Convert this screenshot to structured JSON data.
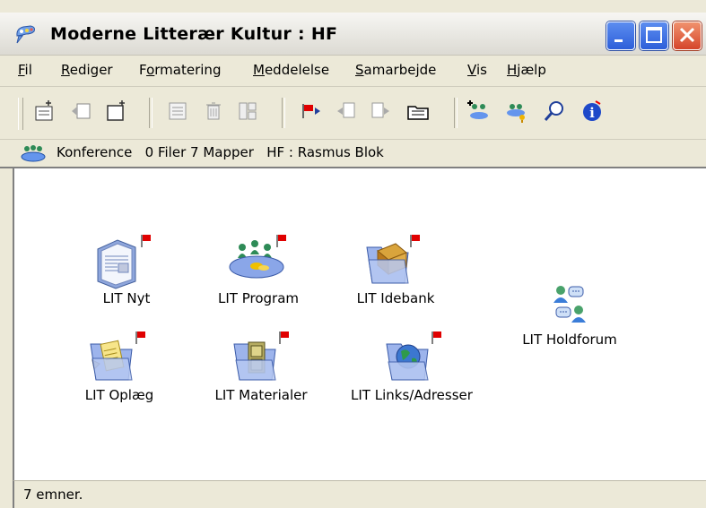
{
  "window": {
    "title": "Moderne Litterær Kultur : HF"
  },
  "menu": [
    {
      "pre": "",
      "u": "F",
      "post": "il"
    },
    {
      "pre": "",
      "u": "R",
      "post": "ediger"
    },
    {
      "pre": "F",
      "u": "o",
      "post": "rmatering"
    },
    {
      "pre": "",
      "u": "M",
      "post": "eddelelse"
    },
    {
      "pre": "",
      "u": "S",
      "post": "amarbejde"
    },
    {
      "pre": "",
      "u": "V",
      "post": "is"
    },
    {
      "pre": "",
      "u": "H",
      "post": "jælp"
    }
  ],
  "toolbar_icons": [
    "new-document-icon",
    "reply-icon",
    "new-folder-icon",
    "list-icon",
    "delete-icon",
    "properties-icon",
    "flag-icon",
    "forward-icon",
    "move-icon",
    "open-folder-icon",
    "add-member-icon",
    "members-key-icon",
    "search-icon",
    "info-icon"
  ],
  "infobar": {
    "conference": "Konference",
    "files": "0 Filer",
    "folders": "7 Mapper",
    "path": "HF : Rasmus Blok"
  },
  "items": [
    {
      "label": "LIT Nyt",
      "icon": "newspaper-icon",
      "flag": true
    },
    {
      "label": "LIT Program",
      "icon": "people-table-icon",
      "flag": true
    },
    {
      "label": "LIT Idebank",
      "icon": "box-folder-icon",
      "flag": true
    },
    {
      "label": "LIT Oplæg",
      "icon": "paper-folder-icon",
      "flag": true
    },
    {
      "label": "LIT Materialer",
      "icon": "cabinet-folder-icon",
      "flag": true
    },
    {
      "label": "LIT Links/Adresser",
      "icon": "globe-folder-icon",
      "flag": true
    },
    {
      "label": "LIT Holdforum",
      "icon": "chat-people-icon",
      "flag": false
    }
  ],
  "status": "7 emner."
}
